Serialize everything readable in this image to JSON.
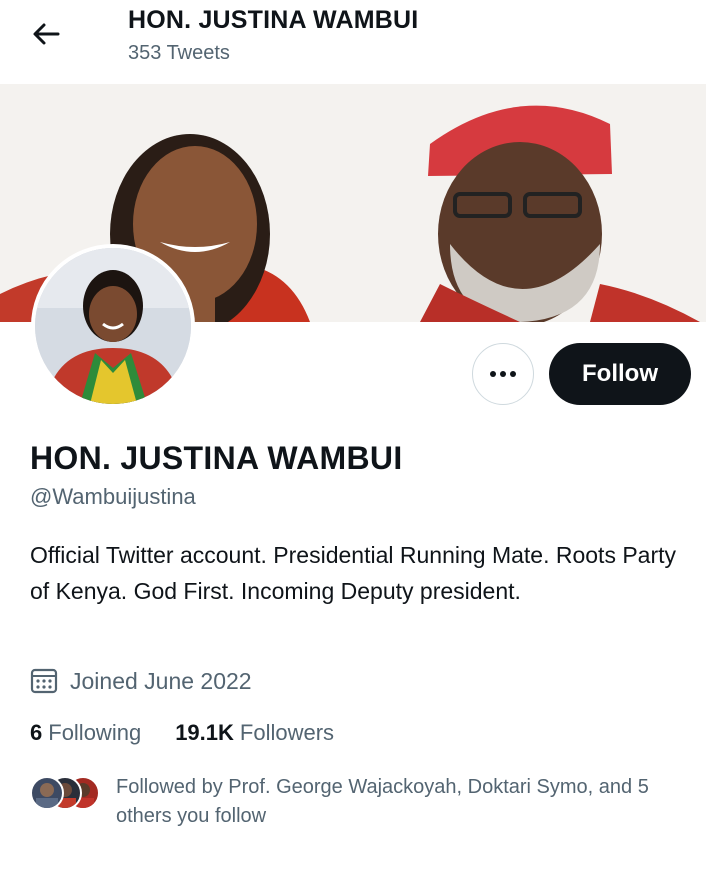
{
  "header": {
    "title": "HON. JUSTINA WAMBUI",
    "subtitle": "353 Tweets",
    "back_icon": "arrow-left-icon"
  },
  "profile": {
    "name": "HON. JUSTINA WAMBUI",
    "handle": "@Wambuijustina",
    "bio": "Official Twitter account. Presidential Running Mate. Roots Party of Kenya. God First. Incoming Deputy president.",
    "joined": "Joined June 2022",
    "joined_icon": "calendar-icon"
  },
  "actions": {
    "more_icon": "more-horizontal-icon",
    "follow_label": "Follow"
  },
  "stats": {
    "following_count": "6",
    "following_label": "Following",
    "followers_count": "19.1K",
    "followers_label": "Followers"
  },
  "followed_by": {
    "text": "Followed by Prof. George Wajackoyah, Doktari Symo, and 5 others you follow"
  },
  "colors": {
    "text_primary": "#0f1419",
    "text_secondary": "#536471",
    "follow_button_bg": "#0f1419",
    "border": "#cfd9de"
  }
}
